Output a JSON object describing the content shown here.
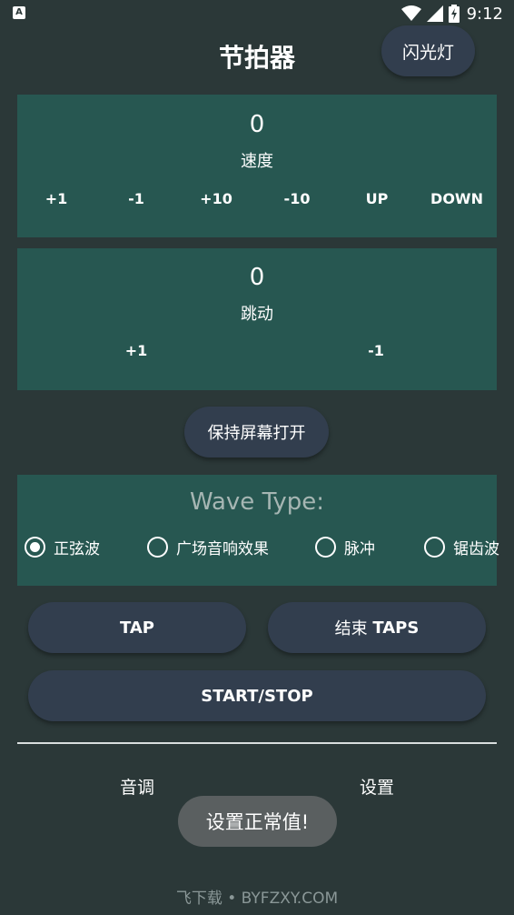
{
  "status_bar": {
    "app_icon_letter": "A",
    "time": "9:12",
    "battery_glyph": "⚡"
  },
  "header": {
    "title": "节拍器",
    "flash_button_label": "闪光灯"
  },
  "speed_panel": {
    "value": "0",
    "label": "速度",
    "buttons": [
      "+1",
      "-1",
      "+10",
      "-10",
      "UP",
      "DOWN"
    ]
  },
  "jump_panel": {
    "value": "0",
    "label": "跳动",
    "buttons": [
      "+1",
      "-1"
    ]
  },
  "keep_screen_button_label": "保持屏幕打开",
  "wave_panel": {
    "title": "Wave Type:",
    "options": [
      {
        "label": "正弦波",
        "checked": true
      },
      {
        "label": "广场音响效果",
        "checked": false
      },
      {
        "label": "脉冲",
        "checked": false
      },
      {
        "label": "锯齿波",
        "checked": false
      }
    ]
  },
  "buttons": {
    "tap": "TAP",
    "end_taps_prefix": "结束",
    "end_taps_suffix": "TAPS",
    "start_stop": "START/STOP"
  },
  "bottom_nav": {
    "pitch": "音调",
    "settings": "设置"
  },
  "toast_message": "设置正常值!",
  "watermark": "飞下载 • BYFZXY.COM"
}
